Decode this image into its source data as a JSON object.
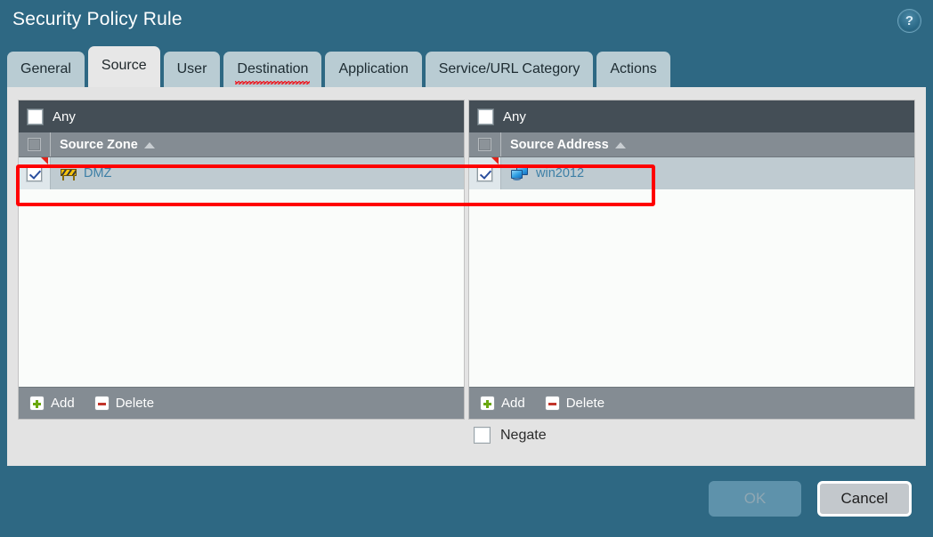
{
  "window": {
    "title": "Security Policy Rule",
    "help_icon": "help-circle-icon",
    "help_glyph": "?"
  },
  "tabs": [
    {
      "label": "General",
      "active": false
    },
    {
      "label": "Source",
      "active": true
    },
    {
      "label": "User",
      "active": false
    },
    {
      "label": "Destination",
      "active": false,
      "misspelled": true
    },
    {
      "label": "Application",
      "active": false
    },
    {
      "label": "Service/URL Category",
      "active": false
    },
    {
      "label": "Actions",
      "active": false
    }
  ],
  "panes": [
    {
      "any_label": "Any",
      "any_checked": false,
      "column_header": "Source Zone",
      "header_checked": false,
      "sort": "asc",
      "rows": [
        {
          "label": "DMZ",
          "icon": "zone-icon",
          "checked": true,
          "flagged": true
        }
      ],
      "add_label": "Add",
      "delete_label": "Delete"
    },
    {
      "any_label": "Any",
      "any_checked": false,
      "column_header": "Source Address",
      "header_checked": false,
      "sort": "asc",
      "rows": [
        {
          "label": "win2012",
          "icon": "host-icon",
          "checked": true,
          "flagged": true
        }
      ],
      "add_label": "Add",
      "delete_label": "Delete"
    }
  ],
  "negate": {
    "label": "Negate",
    "checked": false
  },
  "footer": {
    "ok_label": "OK",
    "ok_enabled": false,
    "cancel_label": "Cancel",
    "cancel_focused": true
  },
  "colors": {
    "window_chrome": "#2e6883",
    "active_tab": "#e7e7e7",
    "inactive_tab": "#b9ccd3",
    "any_row": "#444e56",
    "header_row": "#848c93",
    "selected_row": "#bfcbd1",
    "link_text": "#3d7fa6",
    "annotation": "#ff0000",
    "add_plus": "#6aa80f",
    "delete_minus": "#c2342a"
  }
}
